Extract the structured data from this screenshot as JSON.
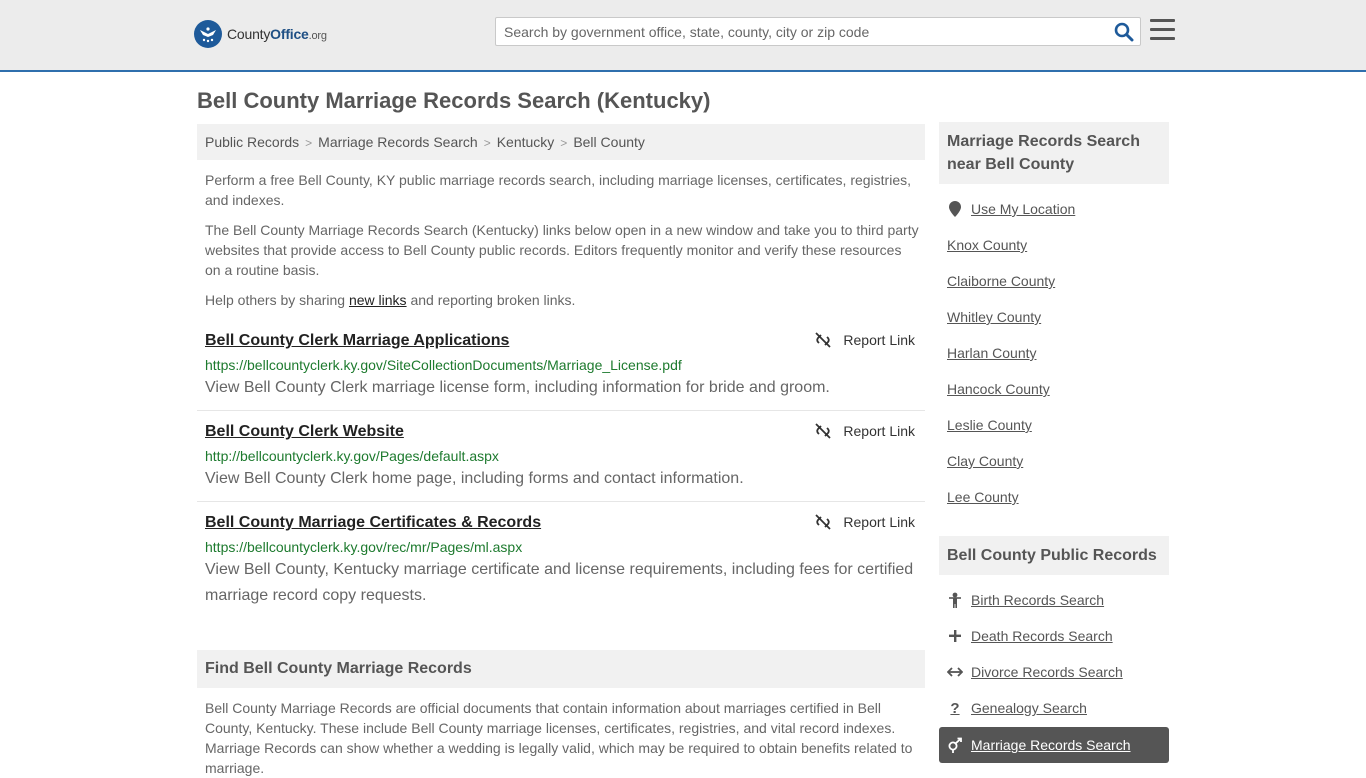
{
  "header": {
    "logo_word": "County",
    "logo_bold": "Office",
    "logo_suffix": ".org",
    "search_placeholder": "Search by government office, state, county, city or zip code"
  },
  "page_title": "Bell County Marriage Records Search (Kentucky)",
  "breadcrumb": [
    "Public Records",
    "Marriage Records Search",
    "Kentucky",
    "Bell County"
  ],
  "intro": {
    "p1": "Perform a free Bell County, KY public marriage records search, including marriage licenses, certificates, registries, and indexes.",
    "p2": "The Bell County Marriage Records Search (Kentucky) links below open in a new window and take you to third party websites that provide access to Bell County public records. Editors frequently monitor and verify these resources on a routine basis.",
    "p3_before": "Help others by sharing ",
    "p3_link": "new links",
    "p3_after": " and reporting broken links."
  },
  "results": [
    {
      "title": "Bell County Clerk Marriage Applications",
      "url": "https://bellcountyclerk.ky.gov/SiteCollectionDocuments/Marriage_License.pdf",
      "desc": "View Bell County Clerk marriage license form, including information for bride and groom.",
      "report": "Report Link"
    },
    {
      "title": "Bell County Clerk Website",
      "url": "http://bellcountyclerk.ky.gov/Pages/default.aspx",
      "desc": "View Bell County Clerk home page, including forms and contact information.",
      "report": "Report Link"
    },
    {
      "title": "Bell County Marriage Certificates & Records",
      "url": "https://bellcountyclerk.ky.gov/rec/mr/Pages/ml.aspx",
      "desc": "View Bell County, Kentucky marriage certificate and license requirements, including fees for certified marriage record copy requests.",
      "report": "Report Link"
    }
  ],
  "find_section": {
    "heading": "Find Bell County Marriage Records",
    "text": "Bell County Marriage Records are official documents that contain information about marriages certified in Bell County, Kentucky. These include Bell County marriage licenses, certificates, registries, and vital record indexes. Marriage Records can show whether a wedding is legally valid, which may be required to obtain benefits related to marriage."
  },
  "sidebar": {
    "nearby_heading": "Marriage Records Search near Bell County",
    "use_location": "Use My Location",
    "nearby": [
      "Knox County",
      "Claiborne County",
      "Whitley County",
      "Harlan County",
      "Hancock County",
      "Leslie County",
      "Clay County",
      "Lee County"
    ],
    "public_heading": "Bell County Public Records",
    "public_links": [
      {
        "label": "Birth Records Search",
        "icon": "baby-icon"
      },
      {
        "label": "Death Records Search",
        "icon": "cross-icon"
      },
      {
        "label": "Divorce Records Search",
        "icon": "arrows-icon"
      },
      {
        "label": "Genealogy Search",
        "icon": "question-icon"
      },
      {
        "label": "Marriage Records Search",
        "icon": "gender-icon"
      }
    ]
  },
  "colors": {
    "header_bg": "#ececec",
    "header_border": "#2f6fad",
    "url_green": "#1d7a2e",
    "active_bg": "#555555"
  }
}
